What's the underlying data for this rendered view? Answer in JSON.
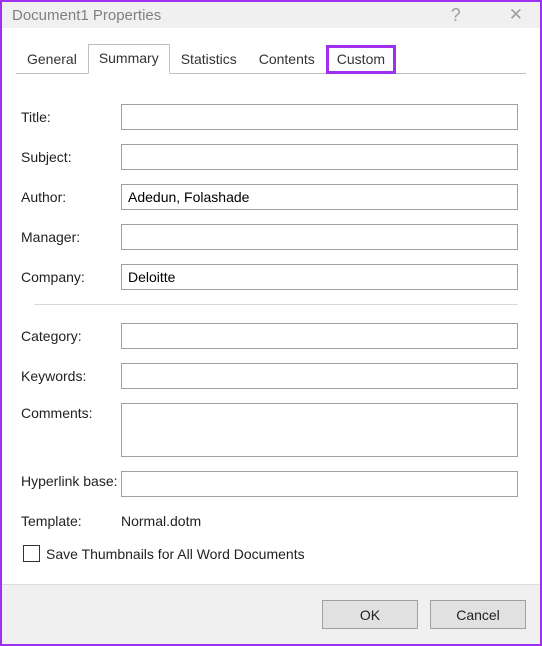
{
  "titlebar": {
    "title": "Document1 Properties"
  },
  "tabs": {
    "general": "General",
    "summary": "Summary",
    "statistics": "Statistics",
    "contents": "Contents",
    "custom": "Custom"
  },
  "fields": {
    "title_label": "Title:",
    "title_value": "",
    "subject_label": "Subject:",
    "subject_value": "",
    "author_label": "Author:",
    "author_value": "Adedun, Folashade",
    "manager_label": "Manager:",
    "manager_value": "",
    "company_label": "Company:",
    "company_value": "Deloitte",
    "category_label": "Category:",
    "category_value": "",
    "keywords_label": "Keywords:",
    "keywords_value": "",
    "comments_label": "Comments:",
    "comments_value": "",
    "hyperlink_label": "Hyperlink base:",
    "hyperlink_value": "",
    "template_label": "Template:",
    "template_value": "Normal.dotm"
  },
  "checkbox": {
    "label": "Save Thumbnails for All Word Documents"
  },
  "buttons": {
    "ok": "OK",
    "cancel": "Cancel"
  }
}
